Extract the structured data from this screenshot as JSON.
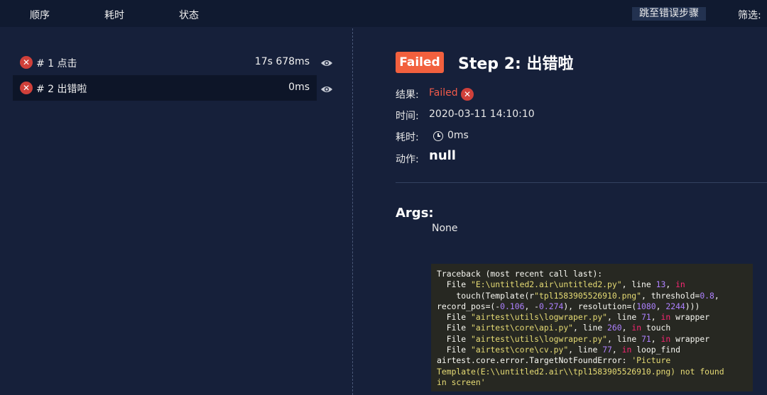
{
  "toolbar": {
    "sort_order": "顺序",
    "sort_duration": "耗时",
    "sort_status": "状态",
    "jump_to_error": "跳至错误步骤",
    "filter_label": "筛选:"
  },
  "steps": [
    {
      "name": "# 1 点击",
      "duration": "17s 678ms",
      "status": "failed"
    },
    {
      "name": "# 2 出错啦",
      "duration": "0ms",
      "status": "failed"
    }
  ],
  "detail": {
    "badge": "Failed",
    "title": "Step 2: 出错啦",
    "result_label": "结果:",
    "result_value": "Failed",
    "time_label": "时间:",
    "time_value": "2020-03-11 14:10:10",
    "duration_label": "耗时:",
    "duration_value": "0ms",
    "action_label": "动作:",
    "action_value": "null",
    "args_label": "Args:",
    "args_value": "None"
  },
  "traceback": [
    [
      {
        "t": "Traceback (most recent call last):"
      }
    ],
    [
      {
        "t": "  File "
      },
      {
        "t": "\"E:\\untitled2.air\\untitled2.py\"",
        "c": "str"
      },
      {
        "t": ", line "
      },
      {
        "t": "13",
        "c": "num"
      },
      {
        "t": ", "
      },
      {
        "t": "in",
        "c": "kw"
      }
    ],
    [
      {
        "t": "    touch(Template(r"
      },
      {
        "t": "\"tpl1583905526910.png\"",
        "c": "str"
      },
      {
        "t": ", threshold="
      },
      {
        "t": "0.8",
        "c": "num"
      },
      {
        "t": ","
      }
    ],
    [
      {
        "t": "record_pos=(-"
      },
      {
        "t": "0.106",
        "c": "num"
      },
      {
        "t": ", -"
      },
      {
        "t": "0.274",
        "c": "num"
      },
      {
        "t": "), resolution=("
      },
      {
        "t": "1080",
        "c": "num"
      },
      {
        "t": ", "
      },
      {
        "t": "2244",
        "c": "num"
      },
      {
        "t": ")))"
      }
    ],
    [
      {
        "t": "  File "
      },
      {
        "t": "\"airtest\\utils\\logwraper.py\"",
        "c": "str"
      },
      {
        "t": ", line "
      },
      {
        "t": "71",
        "c": "num"
      },
      {
        "t": ", "
      },
      {
        "t": "in",
        "c": "kw"
      },
      {
        "t": " wrapper"
      }
    ],
    [
      {
        "t": "  File "
      },
      {
        "t": "\"airtest\\core\\api.py\"",
        "c": "str"
      },
      {
        "t": ", line "
      },
      {
        "t": "260",
        "c": "num"
      },
      {
        "t": ", "
      },
      {
        "t": "in",
        "c": "kw"
      },
      {
        "t": " touch"
      }
    ],
    [
      {
        "t": "  File "
      },
      {
        "t": "\"airtest\\utils\\logwraper.py\"",
        "c": "str"
      },
      {
        "t": ", line "
      },
      {
        "t": "71",
        "c": "num"
      },
      {
        "t": ", "
      },
      {
        "t": "in",
        "c": "kw"
      },
      {
        "t": " wrapper"
      }
    ],
    [
      {
        "t": "  File "
      },
      {
        "t": "\"airtest\\core\\cv.py\"",
        "c": "str"
      },
      {
        "t": ", line "
      },
      {
        "t": "77",
        "c": "num"
      },
      {
        "t": ", "
      },
      {
        "t": "in",
        "c": "kw"
      },
      {
        "t": " loop_find"
      }
    ],
    [
      {
        "t": "airtest.core.error.TargetNotFoundError: "
      },
      {
        "t": "'Picture",
        "c": "str"
      }
    ],
    [
      {
        "t": "Template(E:\\\\untitled2.air\\\\tpl1583905526910.png) not found",
        "c": "str"
      }
    ],
    [
      {
        "t": "in screen'",
        "c": "str"
      }
    ]
  ],
  "colors": {
    "background": "#16203a",
    "topbar": "#101a30",
    "failed_badge": "#f2603e",
    "failed_text": "#f05a4a",
    "error_icon": "#d0403a",
    "code_background": "#272822"
  },
  "icons": {
    "step_status": "close-circle-icon",
    "view": "eye-icon",
    "duration": "clock-icon"
  }
}
